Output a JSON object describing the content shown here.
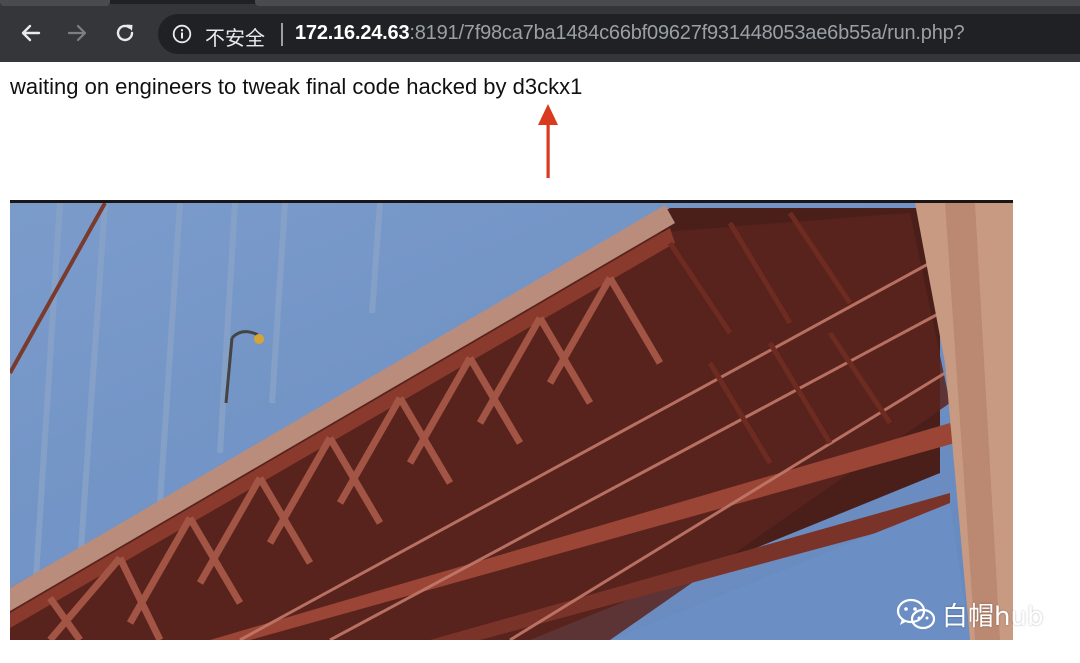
{
  "browser": {
    "security_label": "不安全",
    "url_host": "172.16.24.63",
    "url_rest": ":8191/7f98ca7ba1484c66bf09627f931448053ae6b55a/run.php?"
  },
  "page": {
    "message": "waiting on engineers to tweak final code hacked by d3ckx1"
  },
  "watermark": {
    "text": "白帽hub"
  },
  "colors": {
    "toolbar": "#35363a",
    "omnibox": "#202124",
    "annotation_arrow": "#d9391d",
    "sky": "#6a8fc3",
    "bridge": "#7a2e24"
  }
}
